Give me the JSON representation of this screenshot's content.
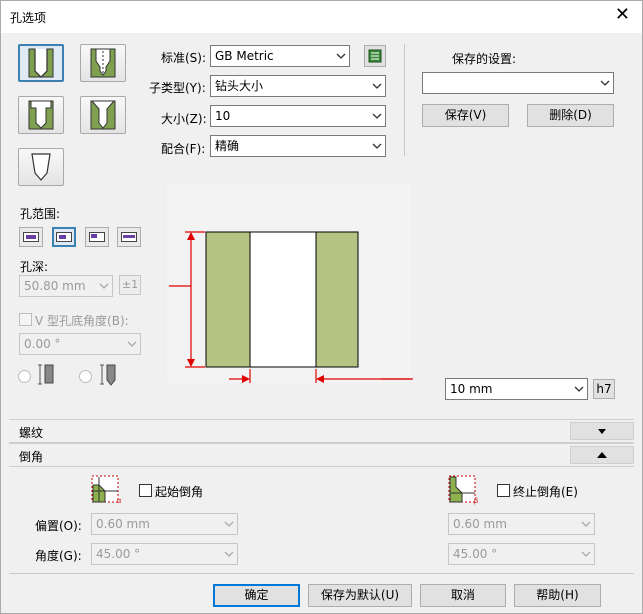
{
  "window": {
    "title": "孔选项",
    "close_glyph": "✕"
  },
  "hole_types": [
    {
      "name": "simple-hole",
      "selected": true
    },
    {
      "name": "taper-hole",
      "selected": false
    },
    {
      "name": "counterbore-hole",
      "selected": false
    },
    {
      "name": "countersink-hole",
      "selected": false
    },
    {
      "name": "counterdrill-hole",
      "selected": false
    }
  ],
  "fields": {
    "standard": {
      "label": "标准(S):",
      "value": "GB Metric"
    },
    "subtype": {
      "label": "子类型(Y):",
      "value": "钻头大小"
    },
    "size": {
      "label": "大小(Z):",
      "value": "10"
    },
    "fit": {
      "label": "配合(F):",
      "value": "精确"
    }
  },
  "saved_settings": {
    "label": "保存的设置:",
    "value": "",
    "save_button": "保存(V)",
    "delete_button": "删除(D)"
  },
  "hole_range": {
    "label": "孔范围:"
  },
  "hole_depth": {
    "label": "孔深:",
    "value": "50.80 mm",
    "pm_button": "±1"
  },
  "v_angle": {
    "label": "V 型孔底角度(B):",
    "value": "0.00 °",
    "checked": false
  },
  "diameter": {
    "value": "10 mm",
    "fit_button": "h7"
  },
  "colors": {
    "wall": "#b5c485",
    "dimension_line": "#e00000",
    "accent": "#0078d7"
  },
  "sections": {
    "thread": {
      "label": "螺纹",
      "collapsed": true
    },
    "chamfer": {
      "label": "倒角",
      "collapsed": false
    }
  },
  "chamfer": {
    "start_label": "起始倒角",
    "end_label": "终止倒角(E)",
    "offset_label": "偏置(O):",
    "angle_label": "角度(G):",
    "start_offset": "0.60 mm",
    "start_angle": "45.00 °",
    "end_offset": "0.60 mm",
    "end_angle": "45.00 °",
    "start_checked": false,
    "end_checked": false
  },
  "footer": {
    "ok": "确定",
    "save_default": "保存为默认(U)",
    "cancel": "取消",
    "help": "帮助(H)"
  }
}
